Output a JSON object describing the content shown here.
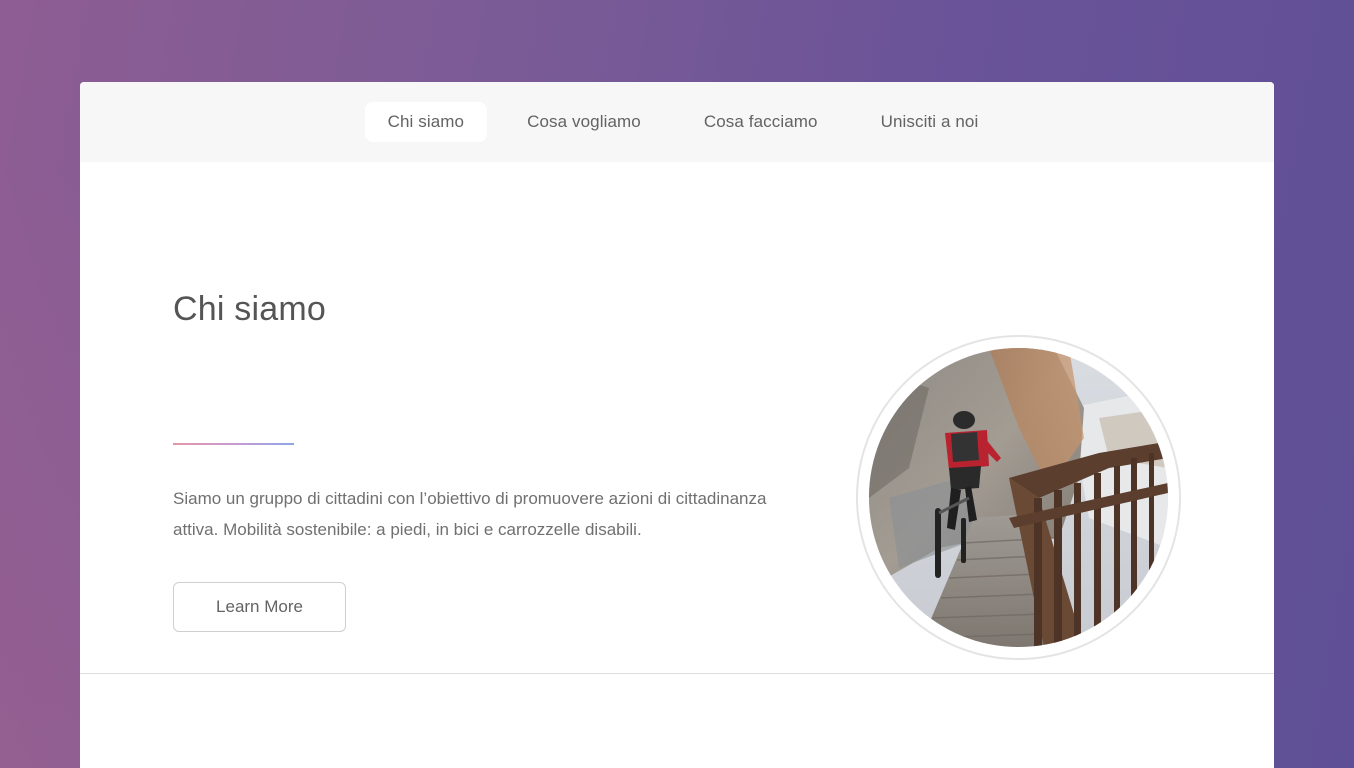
{
  "nav": {
    "items": [
      {
        "label": "Chi siamo",
        "active": true
      },
      {
        "label": "Cosa vogliamo",
        "active": false
      },
      {
        "label": "Cosa facciamo",
        "active": false
      },
      {
        "label": "Unisciti a noi",
        "active": false
      }
    ]
  },
  "intro": {
    "heading": "Chi siamo",
    "body": "Siamo un gruppo di cittadini con l’obiettivo di promuovere azioni di cittadinanza attiva. Mobilità sostenibile: a piedi, in bici e carrozzelle disabili.",
    "button_label": "Learn More",
    "image_subject": "cyclist riding on a wooden boardwalk beside a rock face"
  },
  "colors": {
    "background_start": "#8e5d93",
    "background_end": "#5f4f96",
    "nav_background": "#f7f7f7",
    "text": "#707070",
    "underline_start": "#e497a9",
    "underline_end": "#8fa6e8"
  }
}
